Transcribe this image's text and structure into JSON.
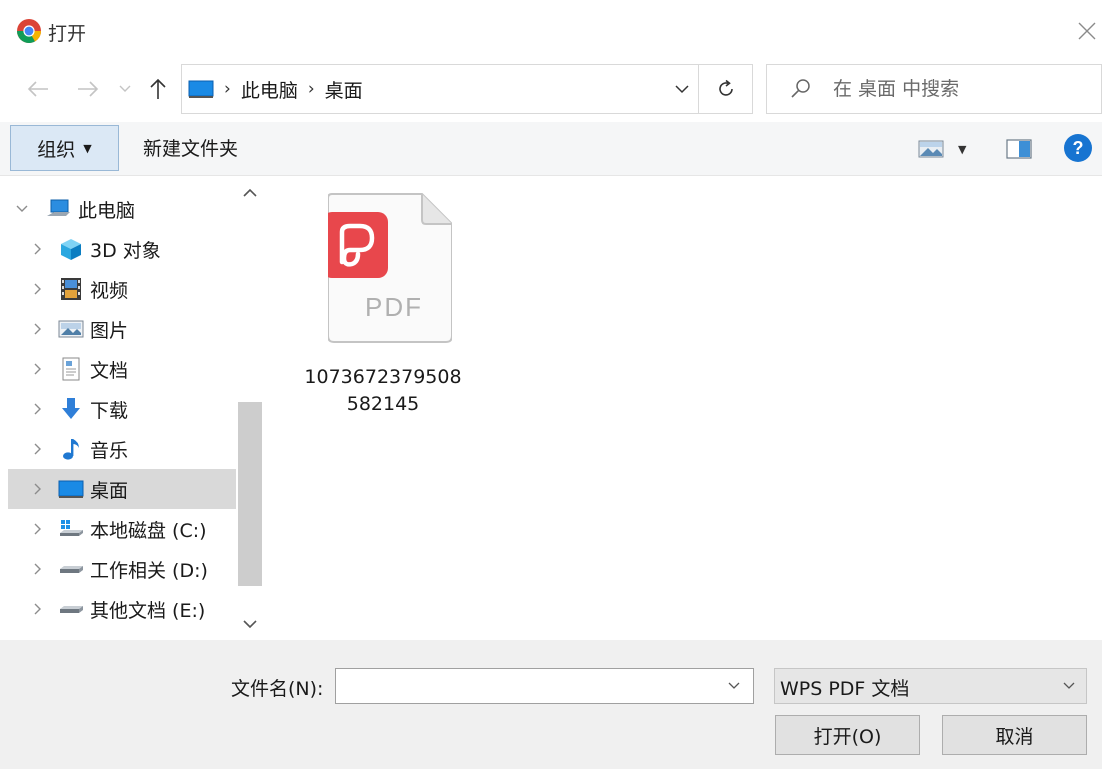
{
  "window": {
    "title": "打开"
  },
  "address_bar": {
    "crumbs": [
      "此电脑",
      "桌面"
    ]
  },
  "search": {
    "placeholder": "在 桌面 中搜索"
  },
  "toolbar": {
    "organize_label": "组织",
    "new_folder_label": "新建文件夹"
  },
  "help": {
    "label": "?"
  },
  "nav_tree": {
    "root": {
      "label": "此电脑",
      "expanded": true
    },
    "items": [
      {
        "label": "3D 对象",
        "icon": "cube-3d-icon"
      },
      {
        "label": "视频",
        "icon": "video-icon"
      },
      {
        "label": "图片",
        "icon": "pictures-icon"
      },
      {
        "label": "文档",
        "icon": "documents-icon"
      },
      {
        "label": "下载",
        "icon": "download-arrow-icon"
      },
      {
        "label": "音乐",
        "icon": "music-note-icon"
      },
      {
        "label": "桌面",
        "icon": "desktop-icon",
        "selected": true
      },
      {
        "label": "本地磁盘 (C:)",
        "icon": "system-drive-icon"
      },
      {
        "label": "工作相关 (D:)",
        "icon": "drive-icon"
      },
      {
        "label": "其他文档 (E:)",
        "icon": "drive-icon"
      }
    ]
  },
  "files": [
    {
      "name": "1073672379508582145",
      "badge": "PDF",
      "icon": "wps-pdf-file-icon"
    }
  ],
  "bottom": {
    "filename_label": "文件名(N):",
    "filename_value": "",
    "file_type": "WPS PDF 文档",
    "open_label": "打开(O)",
    "cancel_label": "取消"
  },
  "colors": {
    "accent": "#1774d1",
    "selection": "#d9d9d9",
    "organize_bg": "#dbe8f5",
    "pdf_red": "#e8474c"
  }
}
